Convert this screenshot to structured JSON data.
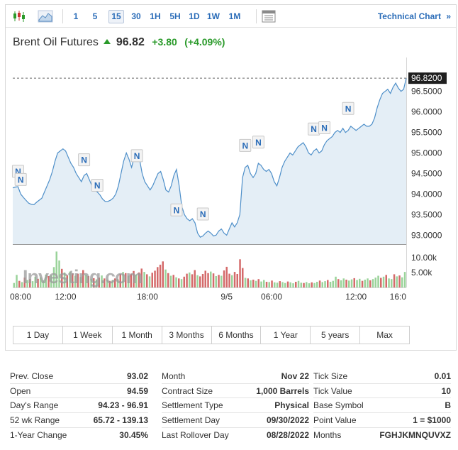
{
  "toolbar": {
    "candles_icon": "candlestick-chart-icon",
    "area_icon": "area-chart-icon",
    "intervals": [
      "1",
      "5",
      "15",
      "30",
      "1H",
      "5H",
      "1D",
      "1W",
      "1M"
    ],
    "active_interval": "15",
    "table_icon": "table-view-icon",
    "technical_chart_label": "Technical Chart",
    "technical_chart_arrow": "»"
  },
  "header": {
    "instrument": "Brent Oil Futures",
    "last": "96.82",
    "change": "+3.80",
    "change_pct": "(+4.09%)"
  },
  "colors": {
    "up": "#2a9a2a",
    "down": "#cc3333",
    "line": "#4e8fc9",
    "area": "#e4eef6",
    "volume_green": "#9ad39a",
    "volume_red": "#d46a6a",
    "price_tag": "#1f1f1f"
  },
  "chart_data": {
    "type": "area",
    "price_tag": "96.8200",
    "y_ticks": [
      "96.5000",
      "96.0000",
      "95.5000",
      "95.0000",
      "94.5000",
      "94.0000",
      "93.5000",
      "93.0000"
    ],
    "ylim": [
      92.78,
      97.22
    ],
    "x_ticks": [
      "08:00",
      "12:00",
      "18:00",
      "9/5",
      "06:00",
      "12:00",
      "16:0"
    ],
    "volume_ticks": [
      "10.00k",
      "5.00k"
    ],
    "volume_max": 12800,
    "watermark": "Investing.com",
    "series": [
      {
        "values": [
          94.15,
          94.17,
          94.18,
          94.0,
          93.92,
          93.85,
          93.78,
          93.75,
          93.74,
          93.8,
          93.85,
          93.9,
          94.05,
          94.2,
          94.35,
          94.55,
          94.8,
          95.0,
          95.05,
          95.1,
          95.05,
          94.9,
          94.75,
          94.65,
          94.5,
          94.4,
          94.3,
          94.45,
          94.5,
          94.35,
          94.2,
          94.1,
          94.05,
          93.98,
          93.88,
          93.82,
          93.82,
          93.85,
          93.9,
          94.0,
          94.2,
          94.5,
          94.8,
          95.0,
          94.85,
          94.65,
          94.9,
          95.0,
          94.85,
          94.5,
          94.3,
          94.2,
          94.1,
          94.2,
          94.35,
          94.5,
          94.55,
          94.35,
          94.1,
          94.05,
          94.2,
          94.45,
          94.6,
          94.2,
          93.7,
          93.5,
          93.4,
          93.35,
          93.4,
          93.3,
          93.05,
          92.95,
          92.98,
          93.05,
          93.1,
          93.05,
          92.98,
          93.0,
          93.1,
          93.15,
          93.05,
          93.0,
          93.15,
          93.3,
          93.2,
          93.3,
          93.5,
          94.4,
          94.65,
          94.7,
          94.5,
          94.4,
          94.5,
          94.75,
          94.7,
          94.6,
          94.55,
          94.6,
          94.5,
          94.3,
          94.2,
          94.4,
          94.65,
          94.8,
          94.9,
          95.0,
          94.95,
          95.05,
          95.15,
          95.2,
          95.25,
          95.15,
          95.0,
          94.95,
          95.05,
          95.1,
          95.0,
          95.05,
          95.2,
          95.3,
          95.35,
          95.4,
          95.5,
          95.55,
          95.5,
          95.6,
          95.5,
          95.55,
          95.65,
          95.6,
          95.55,
          95.6,
          95.65,
          95.7,
          95.65,
          95.65,
          95.7,
          95.85,
          96.1,
          96.3,
          96.45,
          96.5,
          96.55,
          96.45,
          96.6,
          96.7,
          96.58,
          96.5,
          96.55,
          96.82
        ]
      }
    ],
    "volume": [
      {
        "v": 1500,
        "c": "g"
      },
      {
        "v": 4200,
        "c": "g"
      },
      {
        "v": 2200,
        "c": "r"
      },
      {
        "v": 1800,
        "c": "g"
      },
      {
        "v": 3300,
        "c": "r"
      },
      {
        "v": 2500,
        "c": "g"
      },
      {
        "v": 2800,
        "c": "r"
      },
      {
        "v": 2100,
        "c": "g"
      },
      {
        "v": 3600,
        "c": "g"
      },
      {
        "v": 2900,
        "c": "r"
      },
      {
        "v": 3400,
        "c": "g"
      },
      {
        "v": 2400,
        "c": "g"
      },
      {
        "v": 4300,
        "c": "g"
      },
      {
        "v": 3800,
        "c": "r"
      },
      {
        "v": 4100,
        "c": "g"
      },
      {
        "v": 6800,
        "c": "g"
      },
      {
        "v": 12000,
        "c": "g"
      },
      {
        "v": 9000,
        "c": "g"
      },
      {
        "v": 6200,
        "c": "r"
      },
      {
        "v": 5000,
        "c": "g"
      },
      {
        "v": 4100,
        "c": "r"
      },
      {
        "v": 5300,
        "c": "g"
      },
      {
        "v": 4700,
        "c": "r"
      },
      {
        "v": 3900,
        "c": "g"
      },
      {
        "v": 4600,
        "c": "r"
      },
      {
        "v": 3500,
        "c": "g"
      },
      {
        "v": 5800,
        "c": "r"
      },
      {
        "v": 4200,
        "c": "g"
      },
      {
        "v": 3800,
        "c": "r"
      },
      {
        "v": 2900,
        "c": "g"
      },
      {
        "v": 3100,
        "c": "r"
      },
      {
        "v": 2700,
        "c": "g"
      },
      {
        "v": 3300,
        "c": "r"
      },
      {
        "v": 4000,
        "c": "g"
      },
      {
        "v": 3000,
        "c": "r"
      },
      {
        "v": 2600,
        "c": "g"
      },
      {
        "v": 2200,
        "c": "r"
      },
      {
        "v": 2400,
        "c": "g"
      },
      {
        "v": 3000,
        "c": "r"
      },
      {
        "v": 2800,
        "c": "g"
      },
      {
        "v": 4500,
        "c": "r"
      },
      {
        "v": 5200,
        "c": "g"
      },
      {
        "v": 4800,
        "c": "r"
      },
      {
        "v": 3900,
        "c": "g"
      },
      {
        "v": 4600,
        "c": "r"
      },
      {
        "v": 5500,
        "c": "r"
      },
      {
        "v": 4300,
        "c": "g"
      },
      {
        "v": 5000,
        "c": "r"
      },
      {
        "v": 6300,
        "c": "r"
      },
      {
        "v": 5200,
        "c": "g"
      },
      {
        "v": 4400,
        "c": "r"
      },
      {
        "v": 3700,
        "c": "g"
      },
      {
        "v": 4900,
        "c": "r"
      },
      {
        "v": 5600,
        "c": "r"
      },
      {
        "v": 6800,
        "c": "r"
      },
      {
        "v": 7600,
        "c": "r"
      },
      {
        "v": 8700,
        "c": "r"
      },
      {
        "v": 6000,
        "c": "g"
      },
      {
        "v": 4800,
        "c": "r"
      },
      {
        "v": 3900,
        "c": "g"
      },
      {
        "v": 4200,
        "c": "r"
      },
      {
        "v": 3400,
        "c": "g"
      },
      {
        "v": 3000,
        "c": "r"
      },
      {
        "v": 2800,
        "c": "g"
      },
      {
        "v": 3600,
        "c": "r"
      },
      {
        "v": 4600,
        "c": "r"
      },
      {
        "v": 5000,
        "c": "g"
      },
      {
        "v": 4400,
        "c": "r"
      },
      {
        "v": 5800,
        "c": "r"
      },
      {
        "v": 4100,
        "c": "g"
      },
      {
        "v": 3700,
        "c": "r"
      },
      {
        "v": 4500,
        "c": "r"
      },
      {
        "v": 5600,
        "c": "r"
      },
      {
        "v": 4800,
        "c": "r"
      },
      {
        "v": 5300,
        "c": "g"
      },
      {
        "v": 4700,
        "c": "r"
      },
      {
        "v": 3800,
        "c": "g"
      },
      {
        "v": 4200,
        "c": "r"
      },
      {
        "v": 3900,
        "c": "g"
      },
      {
        "v": 5700,
        "c": "r"
      },
      {
        "v": 6900,
        "c": "r"
      },
      {
        "v": 4600,
        "c": "r"
      },
      {
        "v": 4100,
        "c": "g"
      },
      {
        "v": 5200,
        "c": "r"
      },
      {
        "v": 4500,
        "c": "r"
      },
      {
        "v": 9400,
        "c": "r"
      },
      {
        "v": 6500,
        "c": "r"
      },
      {
        "v": 3200,
        "c": "g"
      },
      {
        "v": 3000,
        "c": "r"
      },
      {
        "v": 2400,
        "c": "g"
      },
      {
        "v": 2600,
        "c": "r"
      },
      {
        "v": 2200,
        "c": "g"
      },
      {
        "v": 2800,
        "c": "r"
      },
      {
        "v": 2000,
        "c": "g"
      },
      {
        "v": 2500,
        "c": "g"
      },
      {
        "v": 1900,
        "c": "r"
      },
      {
        "v": 1800,
        "c": "g"
      },
      {
        "v": 2300,
        "c": "r"
      },
      {
        "v": 1700,
        "c": "g"
      },
      {
        "v": 1600,
        "c": "g"
      },
      {
        "v": 2100,
        "c": "r"
      },
      {
        "v": 1800,
        "c": "g"
      },
      {
        "v": 1500,
        "c": "g"
      },
      {
        "v": 2000,
        "c": "r"
      },
      {
        "v": 1700,
        "c": "g"
      },
      {
        "v": 1400,
        "c": "g"
      },
      {
        "v": 1900,
        "c": "r"
      },
      {
        "v": 2200,
        "c": "g"
      },
      {
        "v": 1600,
        "c": "g"
      },
      {
        "v": 1500,
        "c": "r"
      },
      {
        "v": 1800,
        "c": "g"
      },
      {
        "v": 1400,
        "c": "g"
      },
      {
        "v": 1700,
        "c": "r"
      },
      {
        "v": 1500,
        "c": "g"
      },
      {
        "v": 1900,
        "c": "g"
      },
      {
        "v": 2300,
        "c": "r"
      },
      {
        "v": 1800,
        "c": "g"
      },
      {
        "v": 2100,
        "c": "g"
      },
      {
        "v": 2500,
        "c": "r"
      },
      {
        "v": 1900,
        "c": "g"
      },
      {
        "v": 2200,
        "c": "g"
      },
      {
        "v": 3600,
        "c": "g"
      },
      {
        "v": 2800,
        "c": "r"
      },
      {
        "v": 2400,
        "c": "g"
      },
      {
        "v": 3000,
        "c": "g"
      },
      {
        "v": 2600,
        "c": "r"
      },
      {
        "v": 2300,
        "c": "g"
      },
      {
        "v": 2700,
        "c": "g"
      },
      {
        "v": 3100,
        "c": "r"
      },
      {
        "v": 2500,
        "c": "g"
      },
      {
        "v": 2900,
        "c": "g"
      },
      {
        "v": 2200,
        "c": "r"
      },
      {
        "v": 2600,
        "c": "g"
      },
      {
        "v": 3000,
        "c": "g"
      },
      {
        "v": 2400,
        "c": "r"
      },
      {
        "v": 2800,
        "c": "g"
      },
      {
        "v": 3300,
        "c": "g"
      },
      {
        "v": 3900,
        "c": "g"
      },
      {
        "v": 3200,
        "c": "r"
      },
      {
        "v": 3600,
        "c": "g"
      },
      {
        "v": 4200,
        "c": "r"
      },
      {
        "v": 3000,
        "c": "g"
      },
      {
        "v": 2800,
        "c": "g"
      },
      {
        "v": 4400,
        "c": "r"
      },
      {
        "v": 3700,
        "c": "g"
      },
      {
        "v": 4000,
        "c": "r"
      },
      {
        "v": 3400,
        "c": "g"
      },
      {
        "v": 5200,
        "c": "g"
      }
    ],
    "news_markers": [
      {
        "label": "N",
        "index": 2,
        "value": 94.32
      },
      {
        "label": "N",
        "index": 3,
        "value": 94.12
      },
      {
        "label": "N",
        "index": 27,
        "value": 94.6
      },
      {
        "label": "N",
        "index": 32,
        "value": 93.98
      },
      {
        "label": "N",
        "index": 47,
        "value": 94.7
      },
      {
        "label": "N",
        "index": 62,
        "value": 93.38
      },
      {
        "label": "N",
        "index": 72,
        "value": 93.28
      },
      {
        "label": "N",
        "index": 88,
        "value": 94.95
      },
      {
        "label": "N",
        "index": 93,
        "value": 95.03
      },
      {
        "label": "N",
        "index": 114,
        "value": 95.35
      },
      {
        "label": "N",
        "index": 118,
        "value": 95.38
      },
      {
        "label": "N",
        "index": 127,
        "value": 95.85
      }
    ]
  },
  "ranges": [
    "1 Day",
    "1 Week",
    "1 Month",
    "3 Months",
    "6 Months",
    "1 Year",
    "5 years",
    "Max"
  ],
  "stats": {
    "col1": [
      {
        "label": "Prev. Close",
        "value": "93.02"
      },
      {
        "label": "Open",
        "value": "94.59"
      },
      {
        "label": "Day's Range",
        "value": "94.23 - 96.91"
      },
      {
        "label": "52 wk Range",
        "value": "65.72 - 139.13"
      },
      {
        "label": "1-Year Change",
        "value": "30.45%"
      }
    ],
    "col2": [
      {
        "label": "Month",
        "value": "Nov 22"
      },
      {
        "label": "Contract Size",
        "value": "1,000 Barrels"
      },
      {
        "label": "Settlement Type",
        "value": "Physical"
      },
      {
        "label": "Settlement Day",
        "value": "09/30/2022"
      },
      {
        "label": "Last Rollover Day",
        "value": "08/28/2022"
      }
    ],
    "col3": [
      {
        "label": "Tick Size",
        "value": "0.01"
      },
      {
        "label": "Tick Value",
        "value": "10"
      },
      {
        "label": "Base Symbol",
        "value": "B"
      },
      {
        "label": "Point Value",
        "value": "1 = $1000"
      },
      {
        "label": "Months",
        "value": "FGHJKMNQUVXZ"
      }
    ]
  }
}
